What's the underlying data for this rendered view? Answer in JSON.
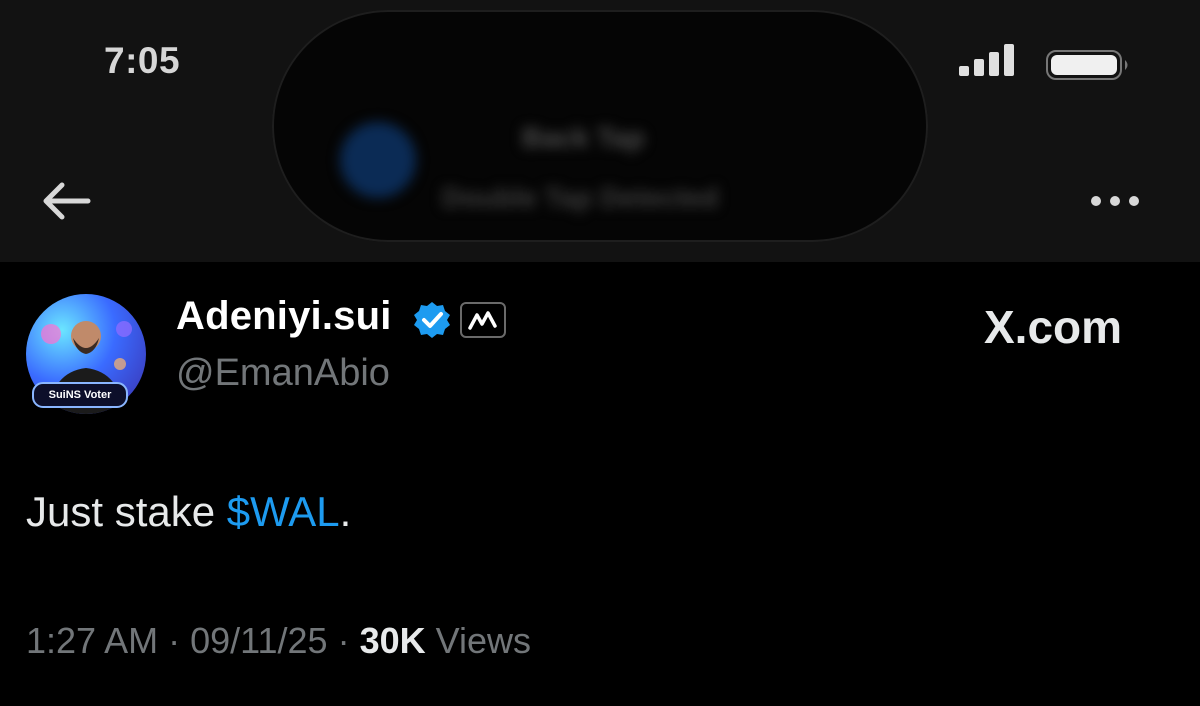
{
  "status_bar": {
    "time": "7:05",
    "island_title": "Back Tap",
    "island_subtitle": "Double Tap Detected"
  },
  "nav": {
    "back_icon": "arrow-left-icon",
    "more_icon": "more-horizontal-icon"
  },
  "tweet": {
    "avatar_badge": "SuiNS Voter",
    "display_name": "Adeniyi.sui",
    "handle": "@EmanAbio",
    "source_label": "X.com",
    "text_prefix": "Just stake ",
    "cashtag": "$WAL",
    "text_suffix": ".",
    "time": "1:27 AM",
    "sep1": " · ",
    "date": "09/11/25",
    "sep2": " · ",
    "views_count": "30K",
    "views_label": " Views"
  },
  "colors": {
    "accent": "#1d9bf0",
    "background": "#000000",
    "header_background": "#121212",
    "muted_text": "#727679"
  }
}
